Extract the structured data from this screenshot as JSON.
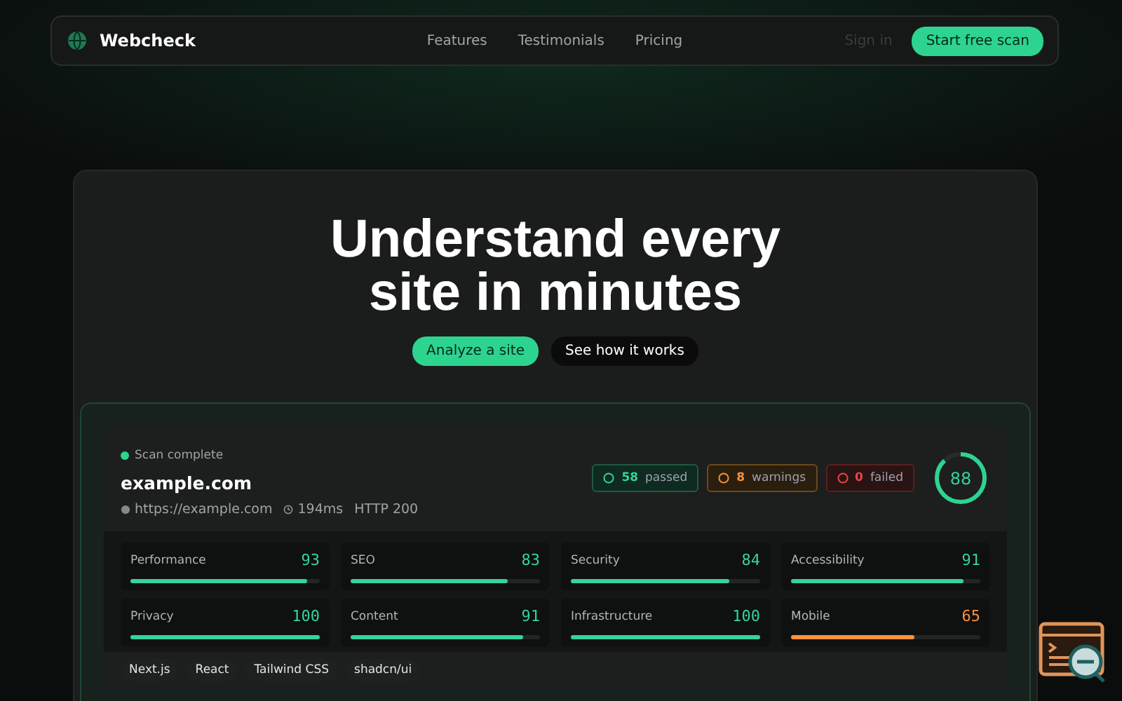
{
  "nav": {
    "brand": "Webcheck",
    "links": [
      "Features",
      "Testimonials",
      "Pricing"
    ],
    "sign_in": "Sign in",
    "cta": "Start free scan"
  },
  "hero": {
    "title_lines": [
      "Understand every",
      "site in minutes"
    ],
    "primary": "Analyze a site",
    "secondary": "See how it works"
  },
  "report": {
    "status": "Scan complete",
    "domain": "example.com",
    "url": "https://example.com",
    "time": "194ms",
    "http": "HTTP 200",
    "badges": [
      {
        "kind": "passed",
        "count": "58",
        "label": "passed"
      },
      {
        "kind": "warning",
        "count": "8",
        "label": "warnings"
      },
      {
        "kind": "failed",
        "count": "0",
        "label": "failed"
      }
    ],
    "score": {
      "value": "88",
      "level": 0.88
    },
    "metrics": [
      {
        "name": "Performance",
        "score": "93",
        "level": 0.93,
        "color": "#34d399"
      },
      {
        "name": "SEO",
        "score": "83",
        "level": 0.83,
        "color": "#34d399"
      },
      {
        "name": "Security",
        "score": "84",
        "level": 0.84,
        "color": "#34d399"
      },
      {
        "name": "Accessibility",
        "score": "91",
        "level": 0.91,
        "color": "#34d399"
      },
      {
        "name": "Privacy",
        "score": "100",
        "level": 1,
        "color": "#34d399"
      },
      {
        "name": "Content",
        "score": "91",
        "level": 0.91,
        "color": "#34d399"
      },
      {
        "name": "Infrastructure",
        "score": "100",
        "level": 1,
        "color": "#34d399"
      },
      {
        "name": "Mobile",
        "score": "65",
        "level": 0.65,
        "color": "#fb923c"
      }
    ],
    "tags": [
      "Next.js",
      "React",
      "Tailwind CSS",
      "shadcn/ui"
    ]
  }
}
